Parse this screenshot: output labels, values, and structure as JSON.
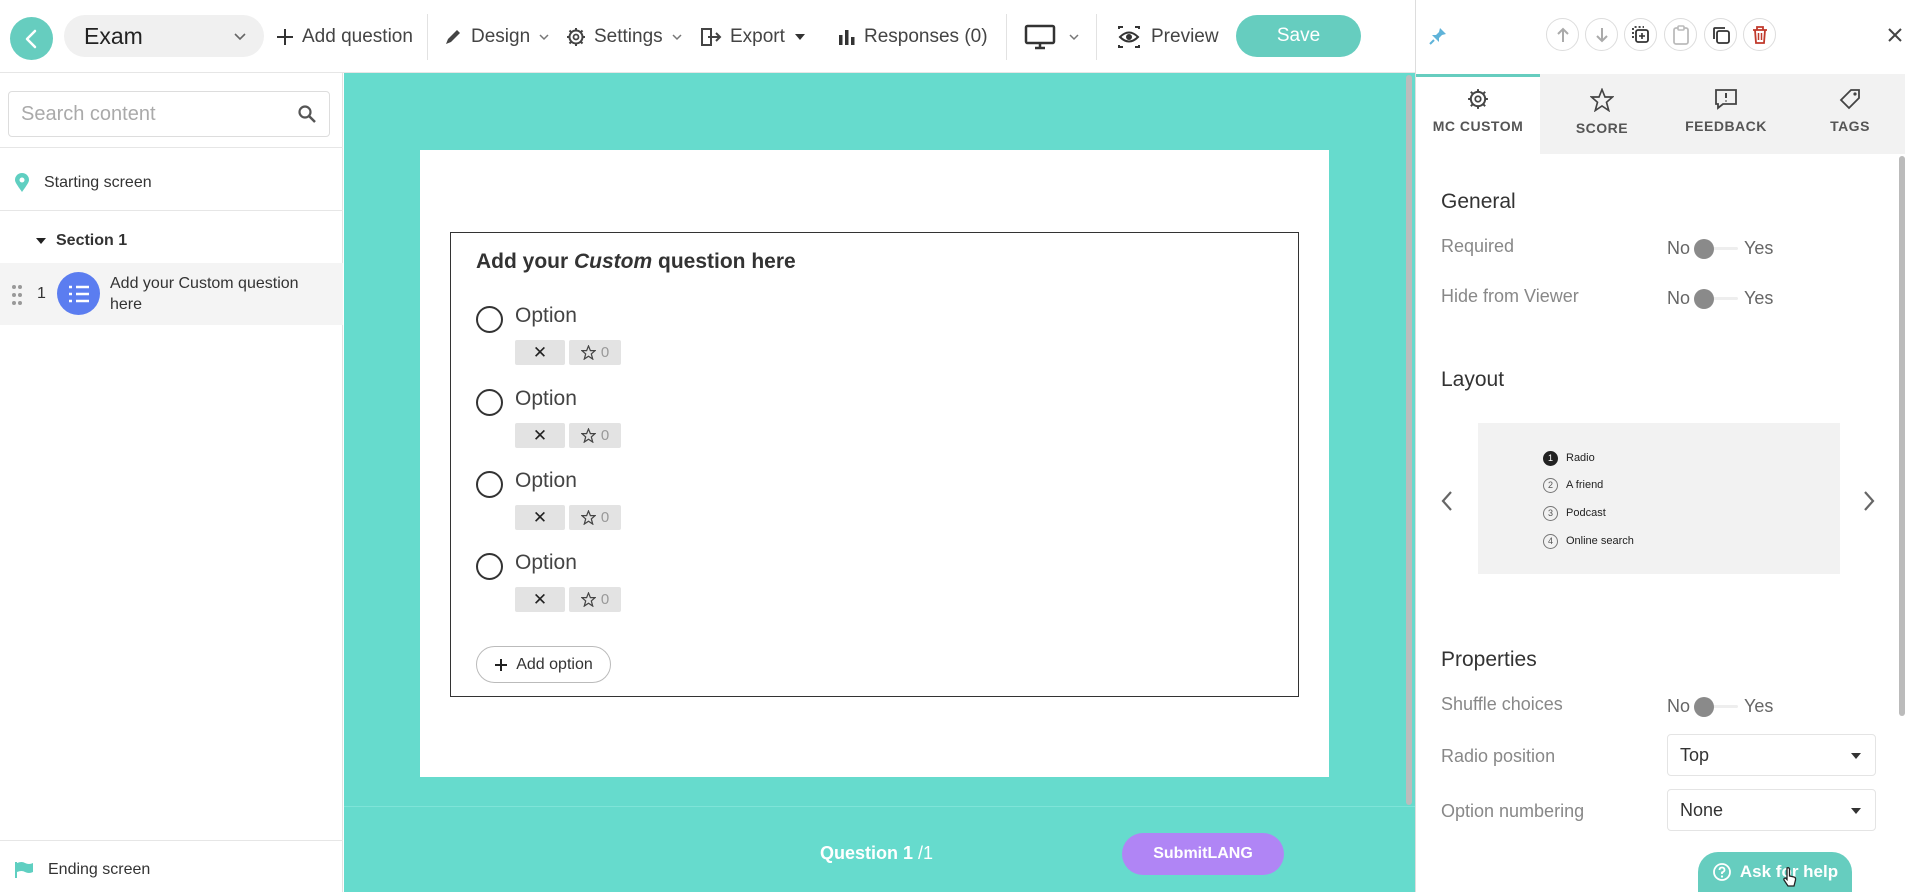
{
  "topbar": {
    "form_name": "Exam",
    "add_question": "Add question",
    "design": "Design",
    "settings": "Settings",
    "export": "Export",
    "responses": "Responses (0)",
    "preview": "Preview",
    "save": "Save"
  },
  "sidebar": {
    "search_placeholder": "Search content",
    "starting_screen": "Starting screen",
    "section": "Section 1",
    "question_number": "1",
    "question_label": "Add your Custom question here",
    "ending_screen": "Ending screen"
  },
  "canvas": {
    "question_title_pre": "Add your ",
    "question_title_em": "Custom",
    "question_title_post": " question here",
    "options": [
      {
        "label": "Option",
        "score": "0"
      },
      {
        "label": "Option",
        "score": "0"
      },
      {
        "label": "Option",
        "score": "0"
      },
      {
        "label": "Option",
        "score": "0"
      }
    ],
    "remove_symbol": "✕",
    "add_option": "Add option",
    "counter_current": "Question 1",
    "counter_total": "/1",
    "submit": "SubmitLANG",
    "background_color": "#66dbcd"
  },
  "right_panel": {
    "tabs": [
      "MC CUSTOM",
      "SCORE",
      "FEEDBACK",
      "TAGS"
    ],
    "active_tab": "MC CUSTOM",
    "general_heading": "General",
    "required_label": "Required",
    "hide_label": "Hide from Viewer",
    "toggle_no": "No",
    "toggle_yes": "Yes",
    "layout_heading": "Layout",
    "layout_preview": [
      {
        "num": "1",
        "text": "Radio"
      },
      {
        "num": "2",
        "text": "A friend"
      },
      {
        "num": "3",
        "text": "Podcast"
      },
      {
        "num": "4",
        "text": "Online search"
      }
    ],
    "properties_heading": "Properties",
    "shuffle_label": "Shuffle choices",
    "radio_position_label": "Radio position",
    "radio_position_value": "Top",
    "numbering_label": "Option numbering",
    "numbering_value": "None",
    "help": "Ask for help"
  },
  "colors": {
    "accent": "#66cdbf",
    "submit": "#b085f5"
  }
}
